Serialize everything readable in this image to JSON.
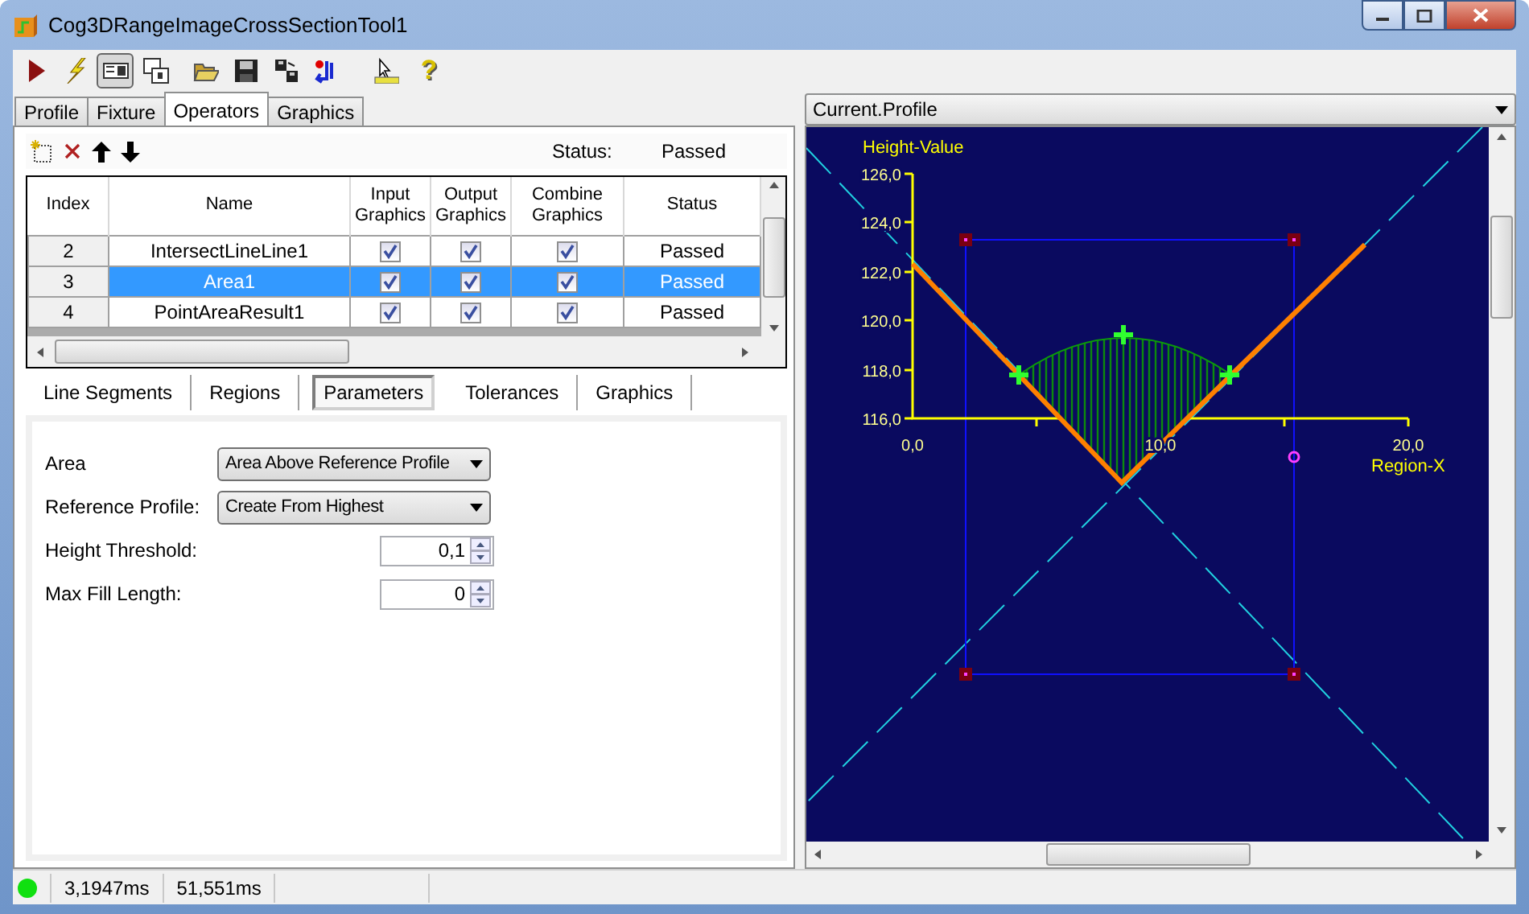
{
  "window": {
    "title": "Cog3DRangeImageCrossSectionTool1"
  },
  "toolbar_buttons": [
    {
      "pressed": false
    },
    {
      "pressed": false
    },
    {
      "pressed": true
    },
    {
      "pressed": false
    },
    {
      "pressed": false
    },
    {
      "pressed": false
    },
    {
      "pressed": false
    },
    {
      "pressed": false
    },
    {
      "pressed": false
    },
    {
      "pressed": false,
      "glyph": "?"
    }
  ],
  "tabs": [
    {
      "label": "Profile",
      "selected": false
    },
    {
      "label": "Fixture",
      "selected": false
    },
    {
      "label": "Operators",
      "selected": true
    },
    {
      "label": "Graphics",
      "selected": false
    }
  ],
  "operators": {
    "status_label": "Status:",
    "status_value": "Passed",
    "columns": [
      "Index",
      "Name",
      "Input Graphics",
      "Output Graphics",
      "Combine Graphics",
      "Status"
    ],
    "rows": [
      {
        "index": "2",
        "name": "IntersectLineLine1",
        "input_graphics": true,
        "output_graphics": true,
        "combine_graphics": true,
        "status": "Passed",
        "selected": false
      },
      {
        "index": "3",
        "name": "Area1",
        "input_graphics": true,
        "output_graphics": true,
        "combine_graphics": true,
        "status": "Passed",
        "selected": true
      },
      {
        "index": "4",
        "name": "PointAreaResult1",
        "input_graphics": true,
        "output_graphics": true,
        "combine_graphics": true,
        "status": "Passed",
        "selected": false
      }
    ]
  },
  "sub_tabs": [
    {
      "label": "Line Segments",
      "selected": false
    },
    {
      "label": "Regions",
      "selected": false
    },
    {
      "label": "Parameters",
      "selected": true
    },
    {
      "label": "Tolerances",
      "selected": false
    },
    {
      "label": "Graphics",
      "selected": false
    }
  ],
  "parameters": [
    {
      "kind": "dropdown",
      "label": "Area",
      "value": "Area Above Reference Profile"
    },
    {
      "kind": "dropdown",
      "label": "Reference Profile:",
      "value": "Create From Highest"
    },
    {
      "kind": "spinner",
      "label": "Height Threshold:",
      "value": "0,1"
    },
    {
      "kind": "spinner",
      "label": "Max Fill Length:",
      "value": "0"
    }
  ],
  "view": {
    "selector": "Current.Profile",
    "y_axis_label": "Height-Value",
    "y_ticks": [
      "126,0",
      "124,0",
      "122,0",
      "120,0",
      "118,0",
      "116,0"
    ],
    "x_ticks": [
      "0,0",
      "10,0",
      "20,0"
    ],
    "x_axis_label": "Region-X"
  },
  "status_bar": {
    "ok": true,
    "times": [
      "3,1947ms",
      "51,551ms"
    ]
  }
}
